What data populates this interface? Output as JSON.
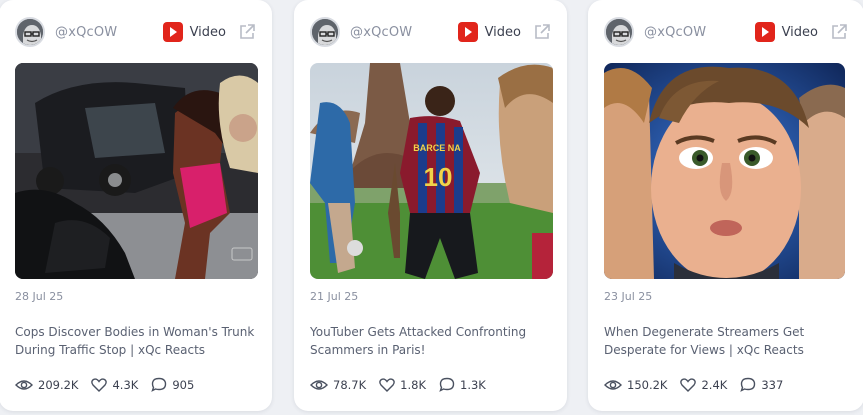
{
  "cards": [
    {
      "author": "@xQcOW",
      "type_label": "Video",
      "date": "28 Jul 25",
      "title": "Cops Discover Bodies in Woman's Trunk During Traffic Stop | xQc Reacts",
      "views": "209.2K",
      "likes": "4.3K",
      "comments": "905"
    },
    {
      "author": "@xQcOW",
      "type_label": "Video",
      "date": "21 Jul 25",
      "title": "YouTuber Gets Attacked Confronting Scammers in Paris!",
      "views": "78.7K",
      "likes": "1.8K",
      "comments": "1.3K",
      "jersey_text": "BARCE  NA",
      "jersey_number": "10"
    },
    {
      "author": "@xQcOW",
      "type_label": "Video",
      "date": "23 Jul 25",
      "title": "When Degenerate Streamers Get Desperate for Views | xQc Reacts",
      "views": "150.2K",
      "likes": "2.4K",
      "comments": "337"
    }
  ],
  "icons": {
    "platform": "youtube-icon",
    "external": "external-link-icon",
    "views": "eye-icon",
    "likes": "heart-icon",
    "comments": "comment-icon"
  },
  "colors": {
    "youtube_red": "#e1251b",
    "card_bg": "#ffffff",
    "page_bg": "#eef0f4",
    "muted_text": "#8a90a0"
  }
}
